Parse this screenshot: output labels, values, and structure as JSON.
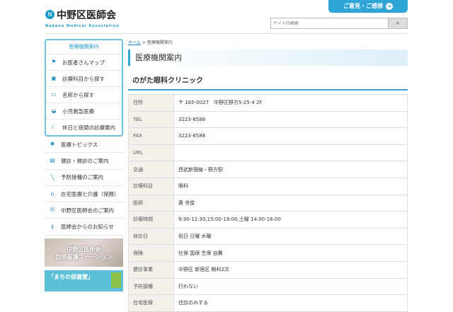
{
  "header": {
    "logo_mark": "N",
    "logo_name": "中野区医師会",
    "logo_en": "Nakano Medical Association",
    "contact_label": "ご意見・ご感想",
    "search_placeholder": "サイト内検索",
    "search_icon": "🔍"
  },
  "sidebar": {
    "box_title": "医療機関案内",
    "box_items": [
      {
        "label": "お医者さんマップ",
        "icon": "map-icon"
      },
      {
        "label": "診療科目から探す",
        "icon": "book-icon"
      },
      {
        "label": "名称から探す",
        "icon": "folder-icon"
      },
      {
        "label": "小児救急医療",
        "icon": "ambulance-icon"
      },
      {
        "label": "休日と夜間の診療案内",
        "icon": "moon-icon"
      }
    ],
    "items": [
      {
        "label": "医療トピックス",
        "icon": "bulb-icon"
      },
      {
        "label": "健診・検診のご案内",
        "icon": "clipboard-icon"
      },
      {
        "label": "予防接種のご案内",
        "icon": "syringe-icon"
      },
      {
        "label": "在宅医療と介護（保険）",
        "icon": "house-icon"
      },
      {
        "label": "中野区医師会のご案内",
        "icon": "logo-icon"
      },
      {
        "label": "医師会からのお知らせ",
        "icon": "info-icon"
      }
    ],
    "banner1_line1": "中野区医師会",
    "banner1_line2": "訪問看護ステーション",
    "banner2": "「まちの保健室」"
  },
  "main": {
    "breadcrumb_home": "ホーム",
    "breadcrumb_sep": ">",
    "breadcrumb_current": "医療機関案内",
    "title": "医療機関案内",
    "clinic_name": "のがた眼科クリニック",
    "rows": [
      {
        "label": "住所",
        "value": "〒 165-0027　中野区野方5-25-4 2F"
      },
      {
        "label": "TEL",
        "value": "3223-8588"
      },
      {
        "label": "FAX",
        "value": "3223-8588"
      },
      {
        "label": "URL",
        "value": ""
      },
      {
        "label": "交通",
        "value": "西武新宿線・野方駅"
      },
      {
        "label": "診療科目",
        "value": "眼科"
      },
      {
        "label": "医師",
        "value": "黄 世俊"
      },
      {
        "label": "診療時間",
        "value": "9:30-12:30,15:00-19:00,土曜 14:00-16:00"
      },
      {
        "label": "休診日",
        "value": "祝日 日曜 水曜"
      },
      {
        "label": "保険",
        "value": "社保 国保 生保 自費"
      },
      {
        "label": "健診事業",
        "value": "中野区 新宿区 眼科2次"
      },
      {
        "label": "予防接種",
        "value": "行わない"
      },
      {
        "label": "在宅医療",
        "value": "往診のみする"
      }
    ]
  }
}
